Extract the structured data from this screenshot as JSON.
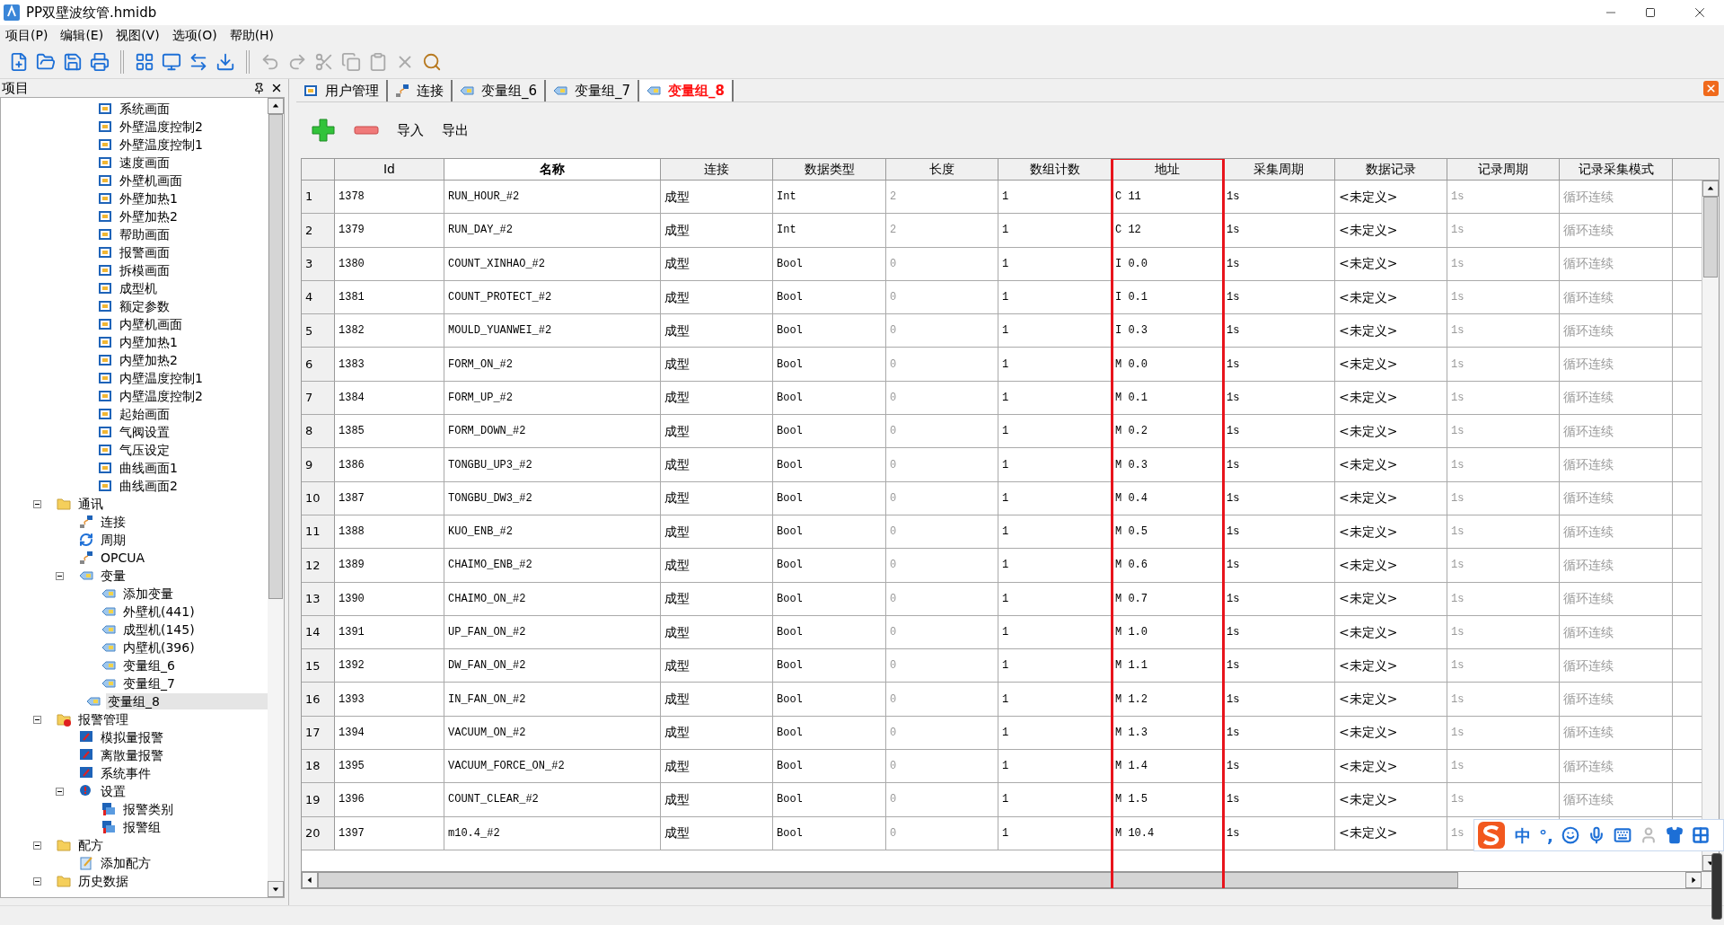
{
  "window": {
    "title": "PP双壁波纹管.hmidb"
  },
  "menu": [
    "项目(P)",
    "编辑(E)",
    "视图(V)",
    "选项(O)",
    "帮助(H)"
  ],
  "toolbar": [
    {
      "kind": "new",
      "disabled": false
    },
    {
      "kind": "open",
      "disabled": false
    },
    {
      "kind": "save",
      "disabled": false
    },
    {
      "kind": "print",
      "disabled": false
    },
    {
      "kind": "sep"
    },
    {
      "kind": "grid",
      "disabled": false
    },
    {
      "kind": "monitor",
      "disabled": false
    },
    {
      "kind": "transfer",
      "disabled": false
    },
    {
      "kind": "download",
      "disabled": false
    },
    {
      "kind": "sep"
    },
    {
      "kind": "undo",
      "disabled": true
    },
    {
      "kind": "redo",
      "disabled": true
    },
    {
      "kind": "cut",
      "disabled": true
    },
    {
      "kind": "copy",
      "disabled": true
    },
    {
      "kind": "paste",
      "disabled": true
    },
    {
      "kind": "delete",
      "disabled": true
    },
    {
      "kind": "find",
      "disabled": false
    }
  ],
  "project_pane": {
    "title": "项目",
    "scrolled_items": [
      "系统画面",
      "外壁温度控制2",
      "外壁温度控制1",
      "速度画面",
      "外壁机画面",
      "外壁加热1",
      "外壁加热2",
      "帮助画面",
      "报警画面",
      "拆模画面",
      "成型机",
      "额定参数",
      "内壁机画面",
      "内壁加热1",
      "内壁加热2",
      "内壁温度控制1",
      "内壁温度控制2",
      "起始画面",
      "气阀设置",
      "气压设定",
      "曲线画面1",
      "曲线画面2"
    ],
    "tree": [
      {
        "label": "通讯",
        "kind": "folder",
        "expanded": true,
        "selected": false,
        "children": [
          {
            "label": "连接",
            "kind": "connection",
            "selected": false
          },
          {
            "label": "周期",
            "kind": "cycle",
            "selected": false
          },
          {
            "label": "OPCUA",
            "kind": "connection",
            "selected": false
          },
          {
            "label": "变量",
            "kind": "variable",
            "expanded": true,
            "selected": false,
            "children": [
              {
                "label": "添加变量",
                "kind": "variable",
                "selected": false
              },
              {
                "label": "外壁机(441)",
                "kind": "variable",
                "selected": false
              },
              {
                "label": "成型机(145)",
                "kind": "variable",
                "selected": false
              },
              {
                "label": "内壁机(396)",
                "kind": "variable",
                "selected": false
              },
              {
                "label": "变量组_6",
                "kind": "variable",
                "selected": false
              },
              {
                "label": "变量组_7",
                "kind": "variable",
                "selected": false
              },
              {
                "label": "变量组_8",
                "kind": "variable",
                "selected": true
              }
            ]
          }
        ]
      },
      {
        "label": "报警管理",
        "kind": "alarm-folder",
        "expanded": true,
        "selected": false,
        "children": [
          {
            "label": "模拟量报警",
            "kind": "alarm",
            "selected": false
          },
          {
            "label": "离散量报警",
            "kind": "alarm",
            "selected": false
          },
          {
            "label": "系统事件",
            "kind": "alarm",
            "selected": false
          },
          {
            "label": "设置",
            "kind": "setting",
            "expanded": true,
            "selected": false,
            "children": [
              {
                "label": "报警类别",
                "kind": "alarm-list",
                "selected": false
              },
              {
                "label": "报警组",
                "kind": "alarm-list",
                "selected": false
              }
            ]
          }
        ]
      },
      {
        "label": "配方",
        "kind": "folder",
        "expanded": true,
        "selected": false,
        "children": [
          {
            "label": "添加配方",
            "kind": "recipe",
            "selected": false
          }
        ]
      },
      {
        "label": "历史数据",
        "kind": "folder",
        "expanded": true,
        "selected": false
      }
    ]
  },
  "tabs": [
    {
      "label": "用户管理",
      "kind": "screen",
      "selected": false
    },
    {
      "label": "连接",
      "kind": "connection",
      "selected": false
    },
    {
      "label": "变量组_6",
      "kind": "variable",
      "selected": false
    },
    {
      "label": "变量组_7",
      "kind": "variable",
      "selected": false
    },
    {
      "label": "变量组_8",
      "kind": "variable",
      "selected": true
    }
  ],
  "actions": [
    {
      "kind": "add"
    },
    {
      "kind": "remove"
    },
    {
      "kind": "text",
      "label": "导入"
    },
    {
      "kind": "text",
      "label": "导出"
    }
  ],
  "table": {
    "columns": [
      {
        "label": "Id",
        "highlighted": false
      },
      {
        "label": "名称",
        "highlighted": false
      },
      {
        "label": "连接",
        "highlighted": false
      },
      {
        "label": "数据类型",
        "highlighted": false
      },
      {
        "label": "长度",
        "highlighted": false
      },
      {
        "label": "数组计数",
        "highlighted": false
      },
      {
        "label": "地址",
        "highlighted": true
      },
      {
        "label": "采集周期",
        "highlighted": false
      },
      {
        "label": "数据记录",
        "highlighted": false
      },
      {
        "label": "记录周期",
        "highlighted": false
      },
      {
        "label": "记录采集模式",
        "highlighted": false
      }
    ],
    "rows": [
      {
        "n": "1",
        "id": "1378",
        "name": "RUN_HOUR_#2",
        "conn": "成型",
        "type": "Int",
        "length": "2",
        "count": "1",
        "address": "C 11",
        "period": "1s",
        "log": "<未定义>",
        "log_period": "1s",
        "mode": "循环连续"
      },
      {
        "n": "2",
        "id": "1379",
        "name": "RUN_DAY_#2",
        "conn": "成型",
        "type": "Int",
        "length": "2",
        "count": "1",
        "address": "C 12",
        "period": "1s",
        "log": "<未定义>",
        "log_period": "1s",
        "mode": "循环连续"
      },
      {
        "n": "3",
        "id": "1380",
        "name": "COUNT_XINHAO_#2",
        "conn": "成型",
        "type": "Bool",
        "length": "0",
        "count": "1",
        "address": "I 0.0",
        "period": "1s",
        "log": "<未定义>",
        "log_period": "1s",
        "mode": "循环连续"
      },
      {
        "n": "4",
        "id": "1381",
        "name": "COUNT_PROTECT_#2",
        "conn": "成型",
        "type": "Bool",
        "length": "0",
        "count": "1",
        "address": "I 0.1",
        "period": "1s",
        "log": "<未定义>",
        "log_period": "1s",
        "mode": "循环连续"
      },
      {
        "n": "5",
        "id": "1382",
        "name": "MOULD_YUANWEI_#2",
        "conn": "成型",
        "type": "Bool",
        "length": "0",
        "count": "1",
        "address": "I 0.3",
        "period": "1s",
        "log": "<未定义>",
        "log_period": "1s",
        "mode": "循环连续"
      },
      {
        "n": "6",
        "id": "1383",
        "name": "FORM_ON_#2",
        "conn": "成型",
        "type": "Bool",
        "length": "0",
        "count": "1",
        "address": "M 0.0",
        "period": "1s",
        "log": "<未定义>",
        "log_period": "1s",
        "mode": "循环连续"
      },
      {
        "n": "7",
        "id": "1384",
        "name": "FORM_UP_#2",
        "conn": "成型",
        "type": "Bool",
        "length": "0",
        "count": "1",
        "address": "M 0.1",
        "period": "1s",
        "log": "<未定义>",
        "log_period": "1s",
        "mode": "循环连续"
      },
      {
        "n": "8",
        "id": "1385",
        "name": "FORM_DOWN_#2",
        "conn": "成型",
        "type": "Bool",
        "length": "0",
        "count": "1",
        "address": "M 0.2",
        "period": "1s",
        "log": "<未定义>",
        "log_period": "1s",
        "mode": "循环连续"
      },
      {
        "n": "9",
        "id": "1386",
        "name": "TONGBU_UP3_#2",
        "conn": "成型",
        "type": "Bool",
        "length": "0",
        "count": "1",
        "address": "M 0.3",
        "period": "1s",
        "log": "<未定义>",
        "log_period": "1s",
        "mode": "循环连续"
      },
      {
        "n": "10",
        "id": "1387",
        "name": "TONGBU_DW3_#2",
        "conn": "成型",
        "type": "Bool",
        "length": "0",
        "count": "1",
        "address": "M 0.4",
        "period": "1s",
        "log": "<未定义>",
        "log_period": "1s",
        "mode": "循环连续"
      },
      {
        "n": "11",
        "id": "1388",
        "name": "KUO_ENB_#2",
        "conn": "成型",
        "type": "Bool",
        "length": "0",
        "count": "1",
        "address": "M 0.5",
        "period": "1s",
        "log": "<未定义>",
        "log_period": "1s",
        "mode": "循环连续"
      },
      {
        "n": "12",
        "id": "1389",
        "name": "CHAIMO_ENB_#2",
        "conn": "成型",
        "type": "Bool",
        "length": "0",
        "count": "1",
        "address": "M 0.6",
        "period": "1s",
        "log": "<未定义>",
        "log_period": "1s",
        "mode": "循环连续"
      },
      {
        "n": "13",
        "id": "1390",
        "name": "CHAIMO_ON_#2",
        "conn": "成型",
        "type": "Bool",
        "length": "0",
        "count": "1",
        "address": "M 0.7",
        "period": "1s",
        "log": "<未定义>",
        "log_period": "1s",
        "mode": "循环连续"
      },
      {
        "n": "14",
        "id": "1391",
        "name": "UP_FAN_ON_#2",
        "conn": "成型",
        "type": "Bool",
        "length": "0",
        "count": "1",
        "address": "M 1.0",
        "period": "1s",
        "log": "<未定义>",
        "log_period": "1s",
        "mode": "循环连续"
      },
      {
        "n": "15",
        "id": "1392",
        "name": "DW_FAN_ON_#2",
        "conn": "成型",
        "type": "Bool",
        "length": "0",
        "count": "1",
        "address": "M 1.1",
        "period": "1s",
        "log": "<未定义>",
        "log_period": "1s",
        "mode": "循环连续"
      },
      {
        "n": "16",
        "id": "1393",
        "name": "IN_FAN_ON_#2",
        "conn": "成型",
        "type": "Bool",
        "length": "0",
        "count": "1",
        "address": "M 1.2",
        "period": "1s",
        "log": "<未定义>",
        "log_period": "1s",
        "mode": "循环连续"
      },
      {
        "n": "17",
        "id": "1394",
        "name": "VACUUM_ON_#2",
        "conn": "成型",
        "type": "Bool",
        "length": "0",
        "count": "1",
        "address": "M 1.3",
        "period": "1s",
        "log": "<未定义>",
        "log_period": "1s",
        "mode": "循环连续"
      },
      {
        "n": "18",
        "id": "1395",
        "name": "VACUUM_FORCE_ON_#2",
        "conn": "成型",
        "type": "Bool",
        "length": "0",
        "count": "1",
        "address": "M 1.4",
        "period": "1s",
        "log": "<未定义>",
        "log_period": "1s",
        "mode": "循环连续"
      },
      {
        "n": "19",
        "id": "1396",
        "name": "COUNT_CLEAR_#2",
        "conn": "成型",
        "type": "Bool",
        "length": "0",
        "count": "1",
        "address": "M 1.5",
        "period": "1s",
        "log": "<未定义>",
        "log_period": "1s",
        "mode": "循环连续"
      },
      {
        "n": "20",
        "id": "1397",
        "name": "m10.4_#2",
        "conn": "成型",
        "type": "Bool",
        "length": "0",
        "count": "1",
        "address": "M 10.4",
        "period": "1s",
        "log": "<未定义>",
        "log_period": "1s"
      }
    ]
  },
  "ime_bar": {
    "items": [
      {
        "kind": "text",
        "label": "中"
      },
      {
        "kind": "text",
        "label": "°,"
      },
      {
        "kind": "emoji"
      },
      {
        "kind": "mic"
      },
      {
        "kind": "keyboard"
      },
      {
        "kind": "user"
      },
      {
        "kind": "shirt"
      },
      {
        "kind": "apps"
      }
    ]
  }
}
